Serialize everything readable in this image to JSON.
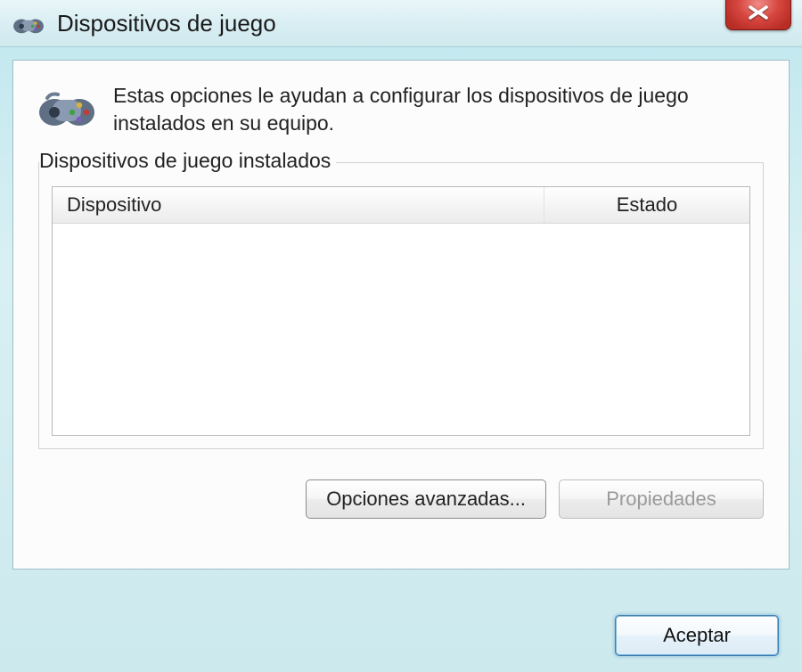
{
  "window": {
    "title": "Dispositivos de juego"
  },
  "intro": {
    "text": "Estas opciones le ayudan a configurar los dispositivos de juego instalados en su equipo."
  },
  "group": {
    "label": "Dispositivos de juego instalados",
    "columns": {
      "device": "Dispositivo",
      "status": "Estado"
    },
    "rows": []
  },
  "buttons": {
    "advanced": "Opciones avanzadas...",
    "properties": "Propiedades",
    "accept": "Aceptar"
  }
}
